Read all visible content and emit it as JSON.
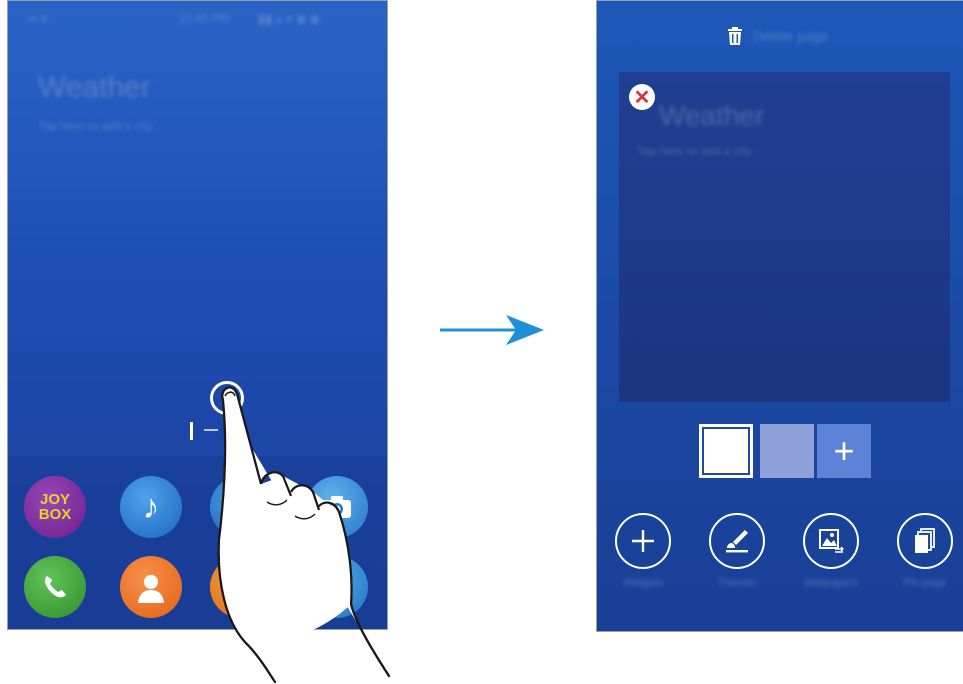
{
  "left_screen": {
    "status_bar": {
      "left": "▪▪ ▾",
      "time": "12:45 PM",
      "icons": "▮▮ ▴ ▾ ◆ ◆"
    },
    "widget": {
      "title": "Weather",
      "subtitle": "Tap here to add a city"
    },
    "apps": [
      {
        "name": "Joybox",
        "label": "JOY BOX",
        "icon": "joybox-icon"
      },
      {
        "name": "Music",
        "label": "♪",
        "icon": "music-note-icon"
      },
      {
        "name": "Internet",
        "label": "",
        "icon": "internet-icon"
      },
      {
        "name": "Camera",
        "label": "📷",
        "icon": "camera-icon"
      },
      {
        "name": "Phone",
        "label": "✆",
        "icon": "phone-icon"
      },
      {
        "name": "Contacts",
        "label": "",
        "icon": "contacts-icon"
      },
      {
        "name": "Messages",
        "label": "",
        "icon": "messages-icon"
      },
      {
        "name": "Globe",
        "label": "",
        "icon": "globe-icon"
      }
    ]
  },
  "right_screen": {
    "remove_page_label": "Delete page",
    "preview": {
      "title": "Weather",
      "subtitle": "Tap here to add a city",
      "remove_icon": "✕"
    },
    "add_page_symbol": "+",
    "tools": [
      {
        "label": "Widgets",
        "icon": "add-circle-icon"
      },
      {
        "label": "Themes",
        "icon": "brush-icon"
      },
      {
        "label": "Wallpapers",
        "icon": "wallpaper-icon"
      },
      {
        "label": "Pin page",
        "icon": "pages-icon"
      }
    ]
  },
  "colors": {
    "arrow": "#1e90d8",
    "screen_blue": "#1d4db2",
    "remove_red": "#e0303a"
  }
}
